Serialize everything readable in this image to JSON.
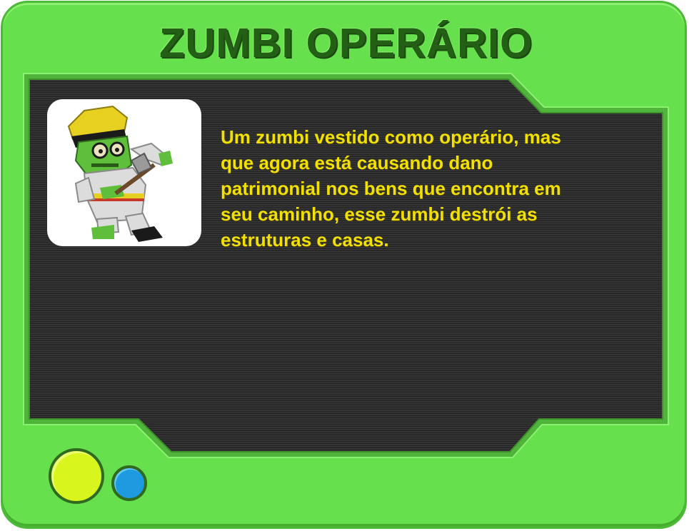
{
  "card": {
    "title": "ZUMBI OPERÁRIO",
    "description": "Um zumbi vestido como operário, mas\nque agora está causando dano\npatrimonial nos bens que encontra em\nseu caminho, esse zumbi destrói as\nestruturas e casas.",
    "portrait_icon": "worker-zombie-icon"
  },
  "colors": {
    "frame": "#66e04c",
    "screen": "#2c2c2c",
    "title": "#245f16",
    "description": "#f2e000",
    "indicator_primary": "#d8f51e",
    "indicator_secondary": "#1e9be0"
  }
}
